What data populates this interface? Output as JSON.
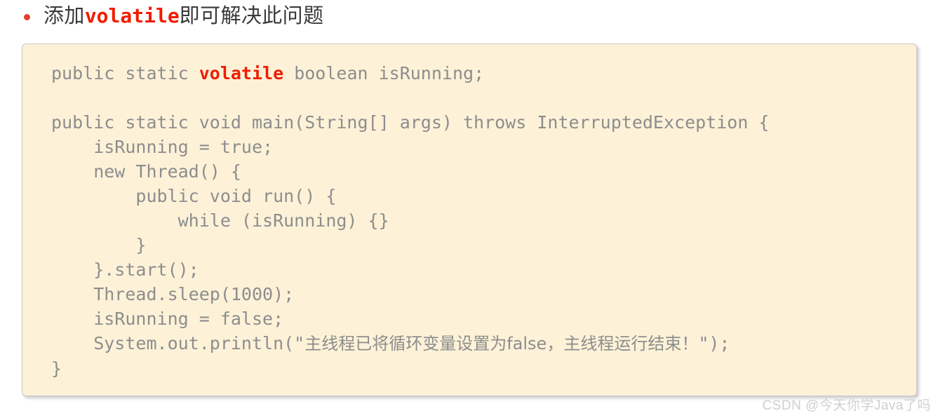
{
  "slide": {
    "bullet": {
      "marker": "bullet-dot",
      "marker_color": "#e0412f",
      "text_before": "添加",
      "keyword": "volatile",
      "text_after": "即可解决此问题",
      "full_text": "添加volatile即可解决此问题"
    },
    "code_block": {
      "background_color": "#fdf2d8",
      "border_color": "#c9c9c9",
      "text_color": "#8d8d8d",
      "keyword_color": "#f01d00",
      "language": "java",
      "lines": [
        {
          "id": "line-1",
          "prefix": "public static ",
          "keyword": "volatile",
          "suffix": " boolean isRunning;"
        },
        {
          "id": "line-2",
          "prefix": "",
          "keyword": "",
          "suffix": ""
        },
        {
          "id": "line-3",
          "prefix": "public static void main(String[] args) throws InterruptedException {",
          "keyword": "",
          "suffix": ""
        },
        {
          "id": "line-4",
          "prefix": "    isRunning = true;",
          "keyword": "",
          "suffix": ""
        },
        {
          "id": "line-5",
          "prefix": "    new Thread() {",
          "keyword": "",
          "suffix": ""
        },
        {
          "id": "line-6",
          "prefix": "        public void run() {",
          "keyword": "",
          "suffix": ""
        },
        {
          "id": "line-7",
          "prefix": "            while (isRunning) {}",
          "keyword": "",
          "suffix": ""
        },
        {
          "id": "line-8",
          "prefix": "        }",
          "keyword": "",
          "suffix": ""
        },
        {
          "id": "line-9",
          "prefix": "    }.start();",
          "keyword": "",
          "suffix": ""
        },
        {
          "id": "line-10",
          "prefix": "    Thread.sleep(1000);",
          "keyword": "",
          "suffix": ""
        },
        {
          "id": "line-11",
          "prefix": "    isRunning = false;",
          "keyword": "",
          "suffix": ""
        },
        {
          "id": "line-12",
          "prefix": "    System.out.println(\"",
          "chinese": "主线程已将循环变量设置为false，主线程运行结束！",
          "suffix": "\");"
        },
        {
          "id": "line-13",
          "prefix": "}",
          "keyword": "",
          "suffix": ""
        }
      ],
      "code_part_1": "public static ",
      "code_keyword": "volatile",
      "code_part_2": " boolean isRunning;\n\npublic static void main(String[] args) throws InterruptedException {\n    isRunning = true;\n    new Thread() {\n        public void run() {\n            while (isRunning) {}\n        }\n    }.start();\n    Thread.sleep(1000);\n    isRunning = false;\n    System.out.println(\"",
      "code_chinese_string": "主线程已将循环变量设置为false，主线程运行结束！",
      "code_part_3": "\");\n}"
    },
    "watermark": "CSDN @今天你学Java了吗"
  }
}
